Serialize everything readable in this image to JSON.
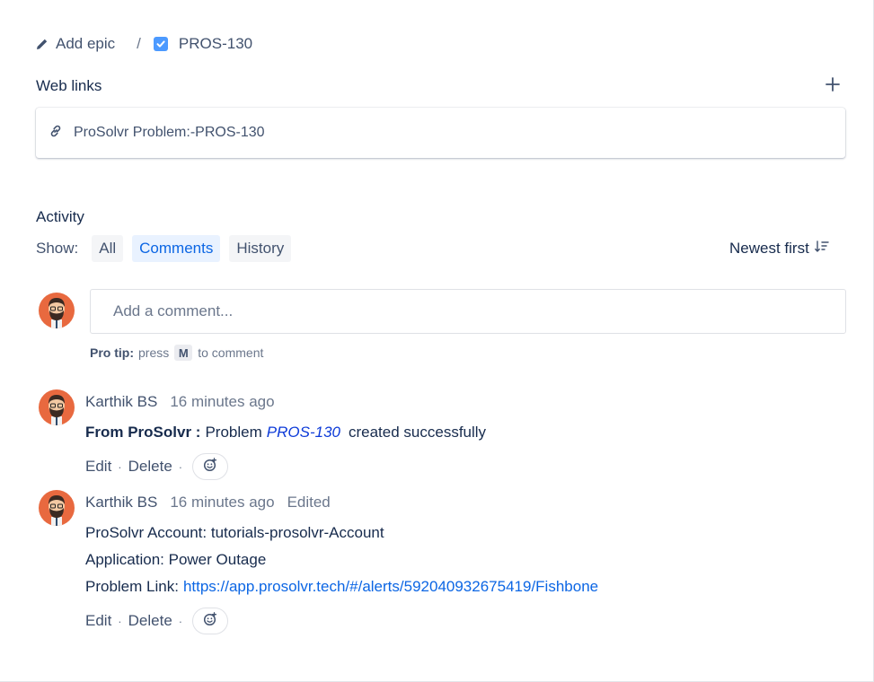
{
  "breadcrumb": {
    "add_epic_label": "Add epic",
    "separator": "/",
    "issue_key": "PROS-130"
  },
  "web_links": {
    "title": "Web links",
    "items": [
      {
        "label": "ProSolvr Problem:-PROS-130"
      }
    ]
  },
  "activity": {
    "title": "Activity",
    "show_label": "Show:",
    "tabs": [
      {
        "label": "All",
        "active": false
      },
      {
        "label": "Comments",
        "active": true
      },
      {
        "label": "History",
        "active": false
      }
    ],
    "sort_label": "Newest first"
  },
  "composer": {
    "placeholder": "Add a comment...",
    "protip_bold": "Pro tip:",
    "protip_press": "press",
    "protip_key": "M",
    "protip_rest": "to comment"
  },
  "comments": [
    {
      "author": "Karthik BS",
      "time": "16 minutes ago",
      "edited": "",
      "bold_prefix": "From ProSolvr :",
      "text_before": "Problem",
      "link": "PROS-130",
      "text_after": "created successfully",
      "edit_label": "Edit",
      "delete_label": "Delete",
      "separator": "·"
    },
    {
      "author": "Karthik BS",
      "time": "16 minutes ago",
      "edited": "Edited",
      "lines": [
        "ProSolvr Account: tutorials-prosolvr-Account",
        "Application: Power Outage"
      ],
      "problem_link_label": "Problem Link:",
      "problem_link_url": "https://app.prosolvr.tech/#/alerts/592040932675419/Fishbone",
      "edit_label": "Edit",
      "delete_label": "Delete",
      "separator": "·"
    }
  ],
  "colors": {
    "avatar_bg": "#e8693f",
    "active_tab_bg": "#e9f2ff",
    "active_tab_text": "#0c66e4",
    "link": "#0c66e4"
  },
  "icons": {
    "add_epic": "pencil-icon",
    "issue_type": "checkbox-icon",
    "add_link": "plus-icon",
    "web_link": "link-icon",
    "sort": "sort-descending-icon",
    "reaction": "add-reaction-icon"
  }
}
